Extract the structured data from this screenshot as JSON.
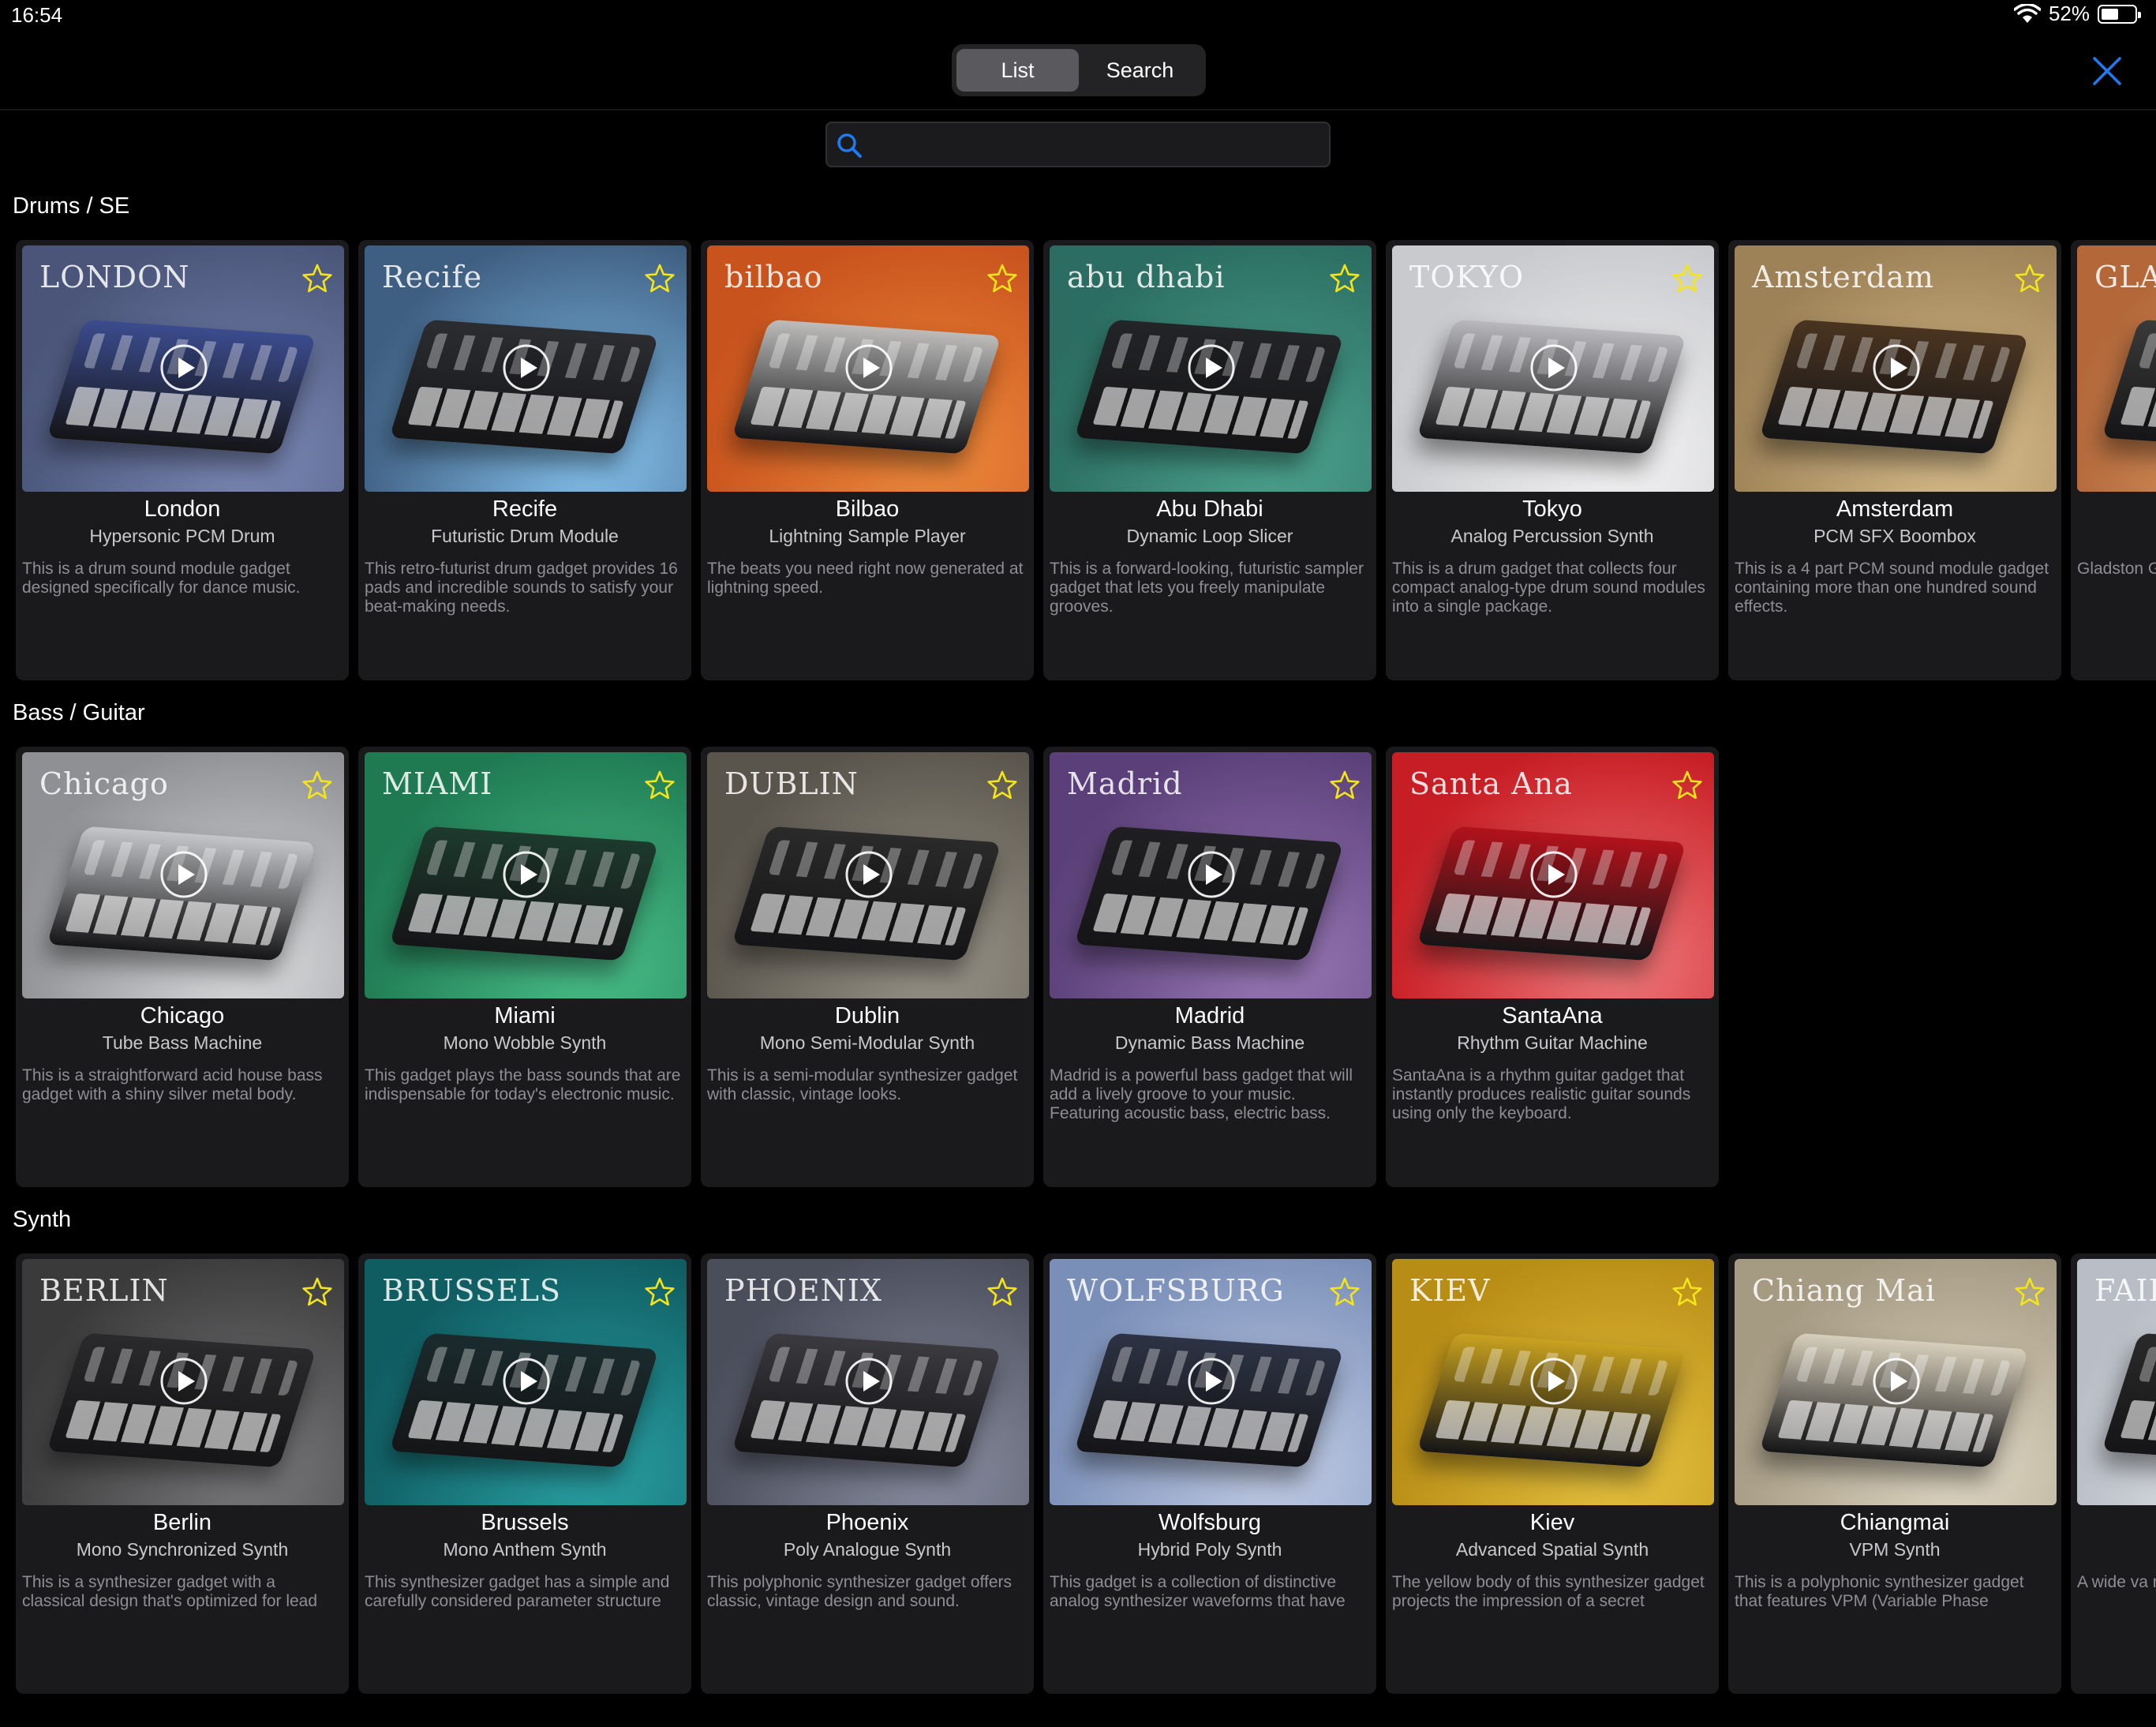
{
  "status_bar": {
    "time": "16:54",
    "battery": "52%",
    "battery_level": 0.52
  },
  "segmented": {
    "options": [
      "List",
      "Search"
    ],
    "selected": "List"
  },
  "search": {
    "value": "",
    "placeholder": ""
  },
  "sections": [
    {
      "title": "Drums / SE",
      "cards": [
        {
          "logo": "LONDON",
          "name": "London",
          "subtitle": "Hypersonic PCM Drum",
          "description": "This is a drum sound module gadget designed specifically for dance music.",
          "bg": "#4a5579",
          "bg2": "#7c89b6",
          "device": "#3b4c8e"
        },
        {
          "logo": "Recife",
          "name": "Recife",
          "subtitle": "Futuristic Drum Module",
          "description": "This retro-futurist drum gadget provides 16 pads and incredible sounds to satisfy your beat-making needs.",
          "bg": "#3f5f82",
          "bg2": "#86c3ee",
          "device": "#2b2d31"
        },
        {
          "logo": "bilbao",
          "name": "Bilbao",
          "subtitle": "Lightning Sample Player",
          "description": "The beats you need right now generated at lightning speed.",
          "bg": "#c9531d",
          "bg2": "#ee8a3c",
          "device": "#bdbcbb"
        },
        {
          "logo": "abu dhabi",
          "name": "Abu Dhabi",
          "subtitle": "Dynamic Loop Slicer",
          "description": "This is a forward-looking, futuristic sampler gadget that lets you freely manipulate grooves.",
          "bg": "#2b6d62",
          "bg2": "#4da48f",
          "device": "#232427"
        },
        {
          "logo": "TOKYO",
          "name": "Tokyo",
          "subtitle": "Analog Percussion Synth",
          "description": "This is a drum gadget that collects four compact analog-type drum sound modules into a single package.",
          "bg": "#c9cacd",
          "bg2": "#f3f3f4",
          "device": "#b9b9bd"
        },
        {
          "logo": "Amsterdam",
          "name": "Amsterdam",
          "subtitle": "PCM SFX Boombox",
          "description": "This is a 4 part PCM sound module gadget containing more than one hundred sound effects.",
          "bg": "#9d8257",
          "bg2": "#d8bd8c",
          "device": "#4a3420"
        },
        {
          "logo": "GLA",
          "name": "",
          "subtitle": "",
          "description": "Gladston Gadget t most sty",
          "bg": "#b4683a",
          "bg2": "#e1a46b",
          "device": "#3a3a3a"
        }
      ]
    },
    {
      "title": "Bass / Guitar",
      "cards": [
        {
          "logo": "Chicago",
          "name": "Chicago",
          "subtitle": "Tube Bass Machine",
          "description": "This is a straightforward acid house bass gadget with a shiny silver metal body.",
          "bg": "#8f9093",
          "bg2": "#dcdddf",
          "device": "#c5c6c9"
        },
        {
          "logo": "MIAMI",
          "name": "Miami",
          "subtitle": "Mono Wobble Synth",
          "description": "This gadget plays the bass sounds that are indispensable for today's electronic music.",
          "bg": "#1f7a52",
          "bg2": "#4ac08a",
          "device": "#1d3a2d"
        },
        {
          "logo": "DUBLIN",
          "name": "Dublin",
          "subtitle": "Mono Semi-Modular Synth",
          "description": "This is a semi-modular synthesizer gadget with classic, vintage looks.",
          "bg": "#5a554c",
          "bg2": "#9a958a",
          "device": "#2a2a2a"
        },
        {
          "logo": "Madrid",
          "name": "Madrid",
          "subtitle": "Dynamic Bass Machine",
          "description": "Madrid is a powerful bass gadget that will add a lively groove to your music. Featuring acoustic bass, electric bass.",
          "bg": "#5a3f78",
          "bg2": "#9a7ab8",
          "device": "#1f1f22"
        },
        {
          "logo": "Santa Ana",
          "name": "SantaAna",
          "subtitle": "Rhythm Guitar Machine",
          "description": "SantaAna is a rhythm guitar gadget that instantly produces realistic guitar sounds using only the keyboard.",
          "bg": "#c71d24",
          "bg2": "#f07a7c",
          "device": "#b3121b"
        }
      ]
    },
    {
      "title": "Synth",
      "cards": [
        {
          "logo": "BERLIN",
          "name": "Berlin",
          "subtitle": "Mono Synchronized Synth",
          "description": "This is a synthesizer gadget with a classical design that's optimized for lead",
          "bg": "#3a3a3b",
          "bg2": "#7b7b7d",
          "device": "#2a2a2c"
        },
        {
          "logo": "BRUSSELS",
          "name": "Brussels",
          "subtitle": "Mono Anthem Synth",
          "description": "This synthesizer gadget has a simple and carefully considered parameter structure",
          "bg": "#0f5c61",
          "bg2": "#2aa3a6",
          "device": "#1a2b2d"
        },
        {
          "logo": "PHOENIX",
          "name": "Phoenix",
          "subtitle": "Poly Analogue Synth",
          "description": "This polyphonic synthesizer gadget offers classic, vintage design and sound.",
          "bg": "#4a4d5a",
          "bg2": "#8a8fa2",
          "device": "#3a3a3f"
        },
        {
          "logo": "WOLFSBURG",
          "name": "Wolfsburg",
          "subtitle": "Hybrid Poly Synth",
          "description": "This gadget is a collection of distinctive analog synthesizer waveforms that have",
          "bg": "#7a8fb8",
          "bg2": "#c2cde6",
          "device": "#2d3344"
        },
        {
          "logo": "KIEV",
          "name": "Kiev",
          "subtitle": "Advanced Spatial Synth",
          "description": "The yellow body of this synthesizer gadget projects the impression of a secret",
          "bg": "#b88d15",
          "bg2": "#e6c23f",
          "device": "#c9a21f"
        },
        {
          "logo": "Chiang Mai",
          "name": "Chiangmai",
          "subtitle": "VPM Synth",
          "description": "This is a polyphonic synthesizer gadget that features VPM (Variable Phase",
          "bg": "#a59a82",
          "bg2": "#e0d8c5",
          "device": "#d7cfbb"
        },
        {
          "logo": "FAIR",
          "name": "",
          "subtitle": "",
          "description": "A wide va ranging f",
          "bg": "#b9bec6",
          "bg2": "#eceff3",
          "device": "#2a2a2a"
        }
      ]
    }
  ]
}
